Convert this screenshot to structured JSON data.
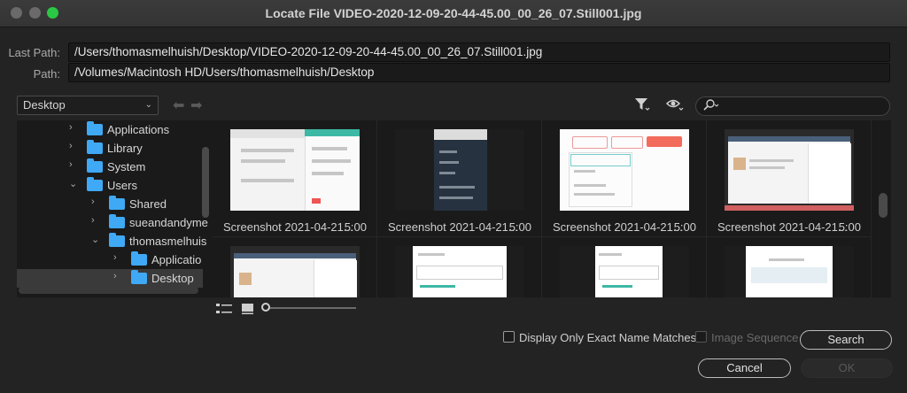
{
  "window": {
    "title": "Locate File VIDEO-2020-12-09-20-44-45.00_00_26_07.Still001.jpg"
  },
  "paths": {
    "last_path_label": "Last Path:",
    "last_path_value": "/Users/thomasmelhuish/Desktop/VIDEO-2020-12-09-20-44-45.00_00_26_07.Still001.jpg",
    "path_label": "Path:",
    "path_value": "/Volumes/Macintosh HD/Users/thomasmelhuish/Desktop"
  },
  "toolbar": {
    "location_dropdown": "Desktop",
    "back_icon": "arrow-left-icon",
    "forward_icon": "arrow-right-icon",
    "filter_icon": "filter-icon",
    "visibility_icon": "eye-icon",
    "search_icon": "search-icon",
    "search_value": ""
  },
  "tree": {
    "items": [
      {
        "label": "Applications",
        "expanded": false
      },
      {
        "label": "Library",
        "expanded": false
      },
      {
        "label": "System",
        "expanded": false
      },
      {
        "label": "Users",
        "expanded": true
      },
      {
        "label": "Shared",
        "expanded": false
      },
      {
        "label": "sueandandyme",
        "expanded": false
      },
      {
        "label": "thomasmelhuis",
        "expanded": true
      },
      {
        "label": "Applicatio",
        "expanded": false
      },
      {
        "label": "Desktop",
        "expanded": false,
        "selected": true
      }
    ]
  },
  "files": {
    "items": [
      {
        "name": "Screenshot 2021-04-21...",
        "duration": "5:00"
      },
      {
        "name": "Screenshot 2021-04-21...",
        "duration": "5:00"
      },
      {
        "name": "Screenshot 2021-04-21...",
        "duration": "5:00"
      },
      {
        "name": "Screenshot 2021-04-21...",
        "duration": "5:00"
      }
    ]
  },
  "bottom": {
    "list_view_icon": "list-view-icon",
    "icon_view_icon": "icon-view-icon",
    "thumb_size_fraction": 0.0,
    "exact_match_label": "Display Only Exact Name Matches",
    "exact_match_checked": false,
    "image_sequence_label": "Image Sequence",
    "image_sequence_checked": false,
    "search_button": "Search",
    "cancel_button": "Cancel",
    "ok_button": "OK"
  },
  "colors": {
    "folder": "#3fa9f5",
    "maximize": "#2ac845",
    "background": "#232323"
  }
}
